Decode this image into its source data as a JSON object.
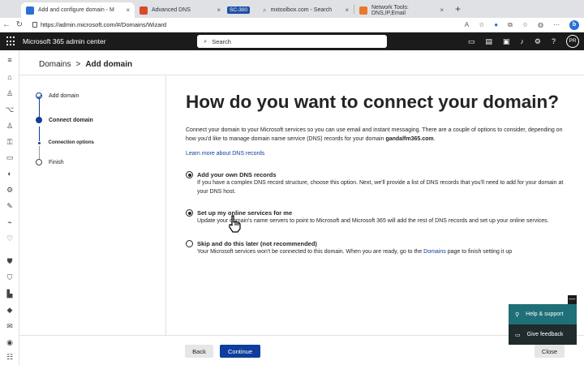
{
  "browser": {
    "tabs": [
      {
        "label": "Add and configure domain - M",
        "active": true,
        "favicon_color": "#2b6fd6"
      },
      {
        "label": "Advanced DNS",
        "active": false,
        "favicon_color": "#d84a2b"
      },
      {
        "label": "SC-300",
        "active": false,
        "badge": true
      },
      {
        "label": "mxtoolbox.com - Search",
        "active": false,
        "favicon_color": "#8a8a8a"
      },
      {
        "label": "Network Tools: DNS,IP,Email",
        "active": false,
        "favicon_color": "#e9782b"
      }
    ],
    "new_tab": "+",
    "url": "https://admin.microsoft.com/#/Domains/Wizard"
  },
  "header": {
    "app_title": "Microsoft 365 admin center",
    "search_placeholder": "Search",
    "avatar_initials": "PR"
  },
  "page": {
    "breadcrumb_root": "Domains",
    "breadcrumb_separator": ">",
    "breadcrumb_current": "Add domain",
    "heading": "How do you want to connect your domain?",
    "intro_before": "Connect your domain to your Microsoft services so you can use email and instant messaging. There are a couple of options to consider, depending on how you'd like to manage domain name service (DNS) records for your domain ",
    "intro_domain": "gandalfm365.com",
    "intro_after": ".",
    "learn_more": "Learn more about DNS records",
    "options": [
      {
        "title": "Add your own DNS records",
        "description": "If you have a complex DNS record structure, choose this option. Next, we'll provide a list of DNS records that you'll need to add for your domain at your DNS host.",
        "selected": true
      },
      {
        "title": "Set up my online services for me",
        "description": "Update your domain's name servers to point to Microsoft and Microsoft 365 will add the rest of DNS records and set up your online services.",
        "selected": true
      },
      {
        "title": "Skip and do this later (not recommended)",
        "description_before": "Your Microsoft services won't be connected to this domain. When you are ready, go to the ",
        "description_link": "Domains",
        "description_after": " page to finish setting it up",
        "selected": false
      }
    ]
  },
  "wizard": {
    "steps": [
      {
        "label": "Add domain",
        "state": "done"
      },
      {
        "label": "Connect domain",
        "state": "current"
      },
      {
        "label": "Connection options",
        "state": "substep"
      },
      {
        "label": "Finish",
        "state": "todo"
      }
    ]
  },
  "footer": {
    "back_label": "Back",
    "continue_label": "Continue",
    "close_label": "Close"
  },
  "help": {
    "help_label": "Help & support",
    "feedback_label": "Give feedback",
    "minimize": "—"
  },
  "colors": {
    "accent": "#0f3d9c",
    "header_bg": "#1b1b1b",
    "help_bg": "#1f6f78"
  }
}
